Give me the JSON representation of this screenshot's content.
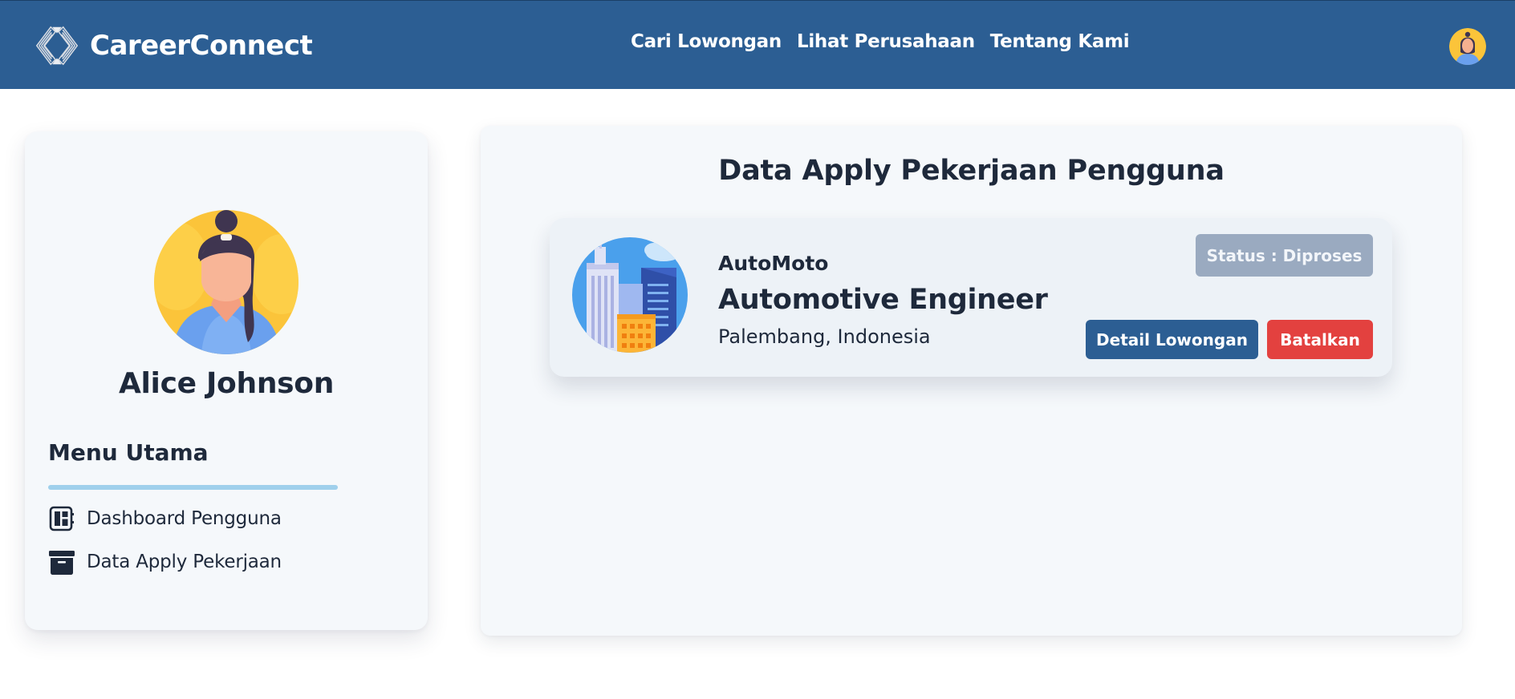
{
  "brand": {
    "name": "CareerConnect"
  },
  "nav": {
    "links": [
      "Cari Lowongan",
      "Lihat Perusahaan",
      "Tentang Kami"
    ]
  },
  "sidebar": {
    "user_name": "Alice Johnson",
    "menu_title": "Menu Utama",
    "items": [
      {
        "label": "Dashboard Pengguna",
        "icon": "dashboard-icon"
      },
      {
        "label": "Data Apply Pekerjaan",
        "icon": "archive-icon"
      }
    ]
  },
  "main": {
    "title": "Data Apply Pekerjaan Pengguna",
    "applications": [
      {
        "company": "AutoMoto",
        "position": "Automotive Engineer",
        "location": "Palembang, Indonesia",
        "status": "Status : Diproses",
        "detail_label": "Detail Lowongan",
        "cancel_label": "Batalkan",
        "logo_icon": "city-buildings-icon"
      }
    ]
  },
  "colors": {
    "navbar": "#2c5e93",
    "primary_button": "#2c5e93",
    "danger_button": "#e3413f",
    "status_badge": "#9aaac0",
    "divider": "#9fd0ec",
    "panel_bg": "#f5f8fb",
    "card_bg": "#edf2f7"
  }
}
